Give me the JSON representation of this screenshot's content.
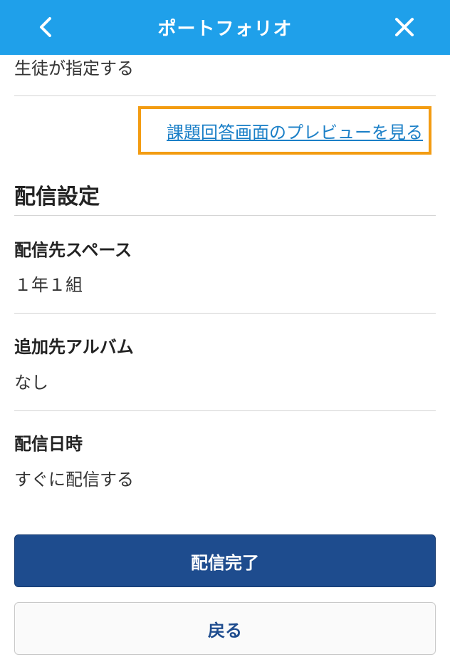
{
  "header": {
    "title": "ポートフォリオ",
    "back_icon": "chevron-left-icon",
    "close_icon": "close-icon",
    "background_color": "#1fa0ea"
  },
  "previous_field": {
    "value": "生徒が指定する"
  },
  "preview": {
    "link_text": "課題回答画面のプレビューを見る",
    "highlight_color": "#f39c12"
  },
  "distribution": {
    "heading": "配信設定",
    "fields": [
      {
        "label": "配信先スペース",
        "value": "１年１組"
      },
      {
        "label": "追加先アルバム",
        "value": "なし"
      },
      {
        "label": "配信日時",
        "value": "すぐに配信する"
      }
    ]
  },
  "actions": {
    "primary_label": "配信完了",
    "secondary_label": "戻る",
    "primary_color": "#1e4c8e"
  }
}
